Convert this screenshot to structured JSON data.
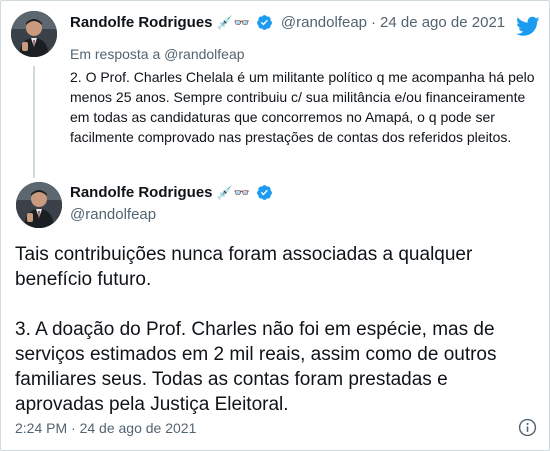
{
  "reply_tweet": {
    "display_name": "Randolfe Rodrigues",
    "emoji": "💉👓",
    "handle": "@randolfeap",
    "separator": "·",
    "date": "24 de ago de 2021",
    "reply_prefix": "Em resposta a",
    "reply_to": "@randolfeap",
    "text": "2. O Prof. Charles Chelala é um militante político q me acompanha há pelo menos 25 anos. Sempre contribuiu c/ sua militância e/ou financeiramente em todas as candidaturas que concorremos no Amapá, o q pode ser facilmente comprovado nas prestações de contas dos referidos pleitos."
  },
  "main_tweet": {
    "display_name": "Randolfe Rodrigues",
    "emoji": "💉👓",
    "handle": "@randolfeap",
    "paragraph_1": "Tais contribuições nunca foram associadas a qualquer benefício futuro.",
    "paragraph_2": "3. A doação do Prof. Charles não foi em espécie, mas de serviços estimados em 2 mil reais, assim como de outros familiares seus. Todas as contas foram prestadas e aprovadas pela Justiça Eleitoral.",
    "time": "2:24 PM",
    "separator": "·",
    "date": "24 de ago de 2021"
  },
  "icons": {
    "brand": "twitter-bird-icon",
    "verified": "verified-badge-icon",
    "info": "info-icon"
  },
  "colors": {
    "brand_blue": "#1d9bf0",
    "text": "#0f1419",
    "secondary_text": "#536471",
    "border": "#cfd9de"
  }
}
